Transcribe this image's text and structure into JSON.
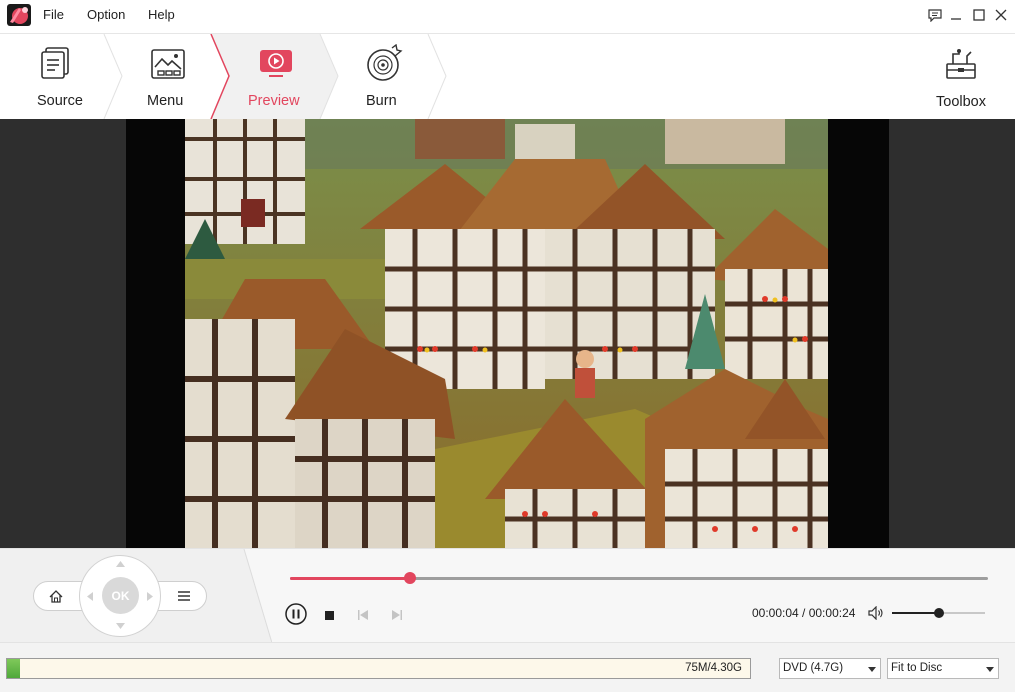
{
  "app": {
    "menu": [
      "File",
      "Option",
      "Help"
    ]
  },
  "steps": [
    {
      "label": "Source",
      "icon": "source-doc-icon",
      "active": false
    },
    {
      "label": "Menu",
      "icon": "menu-template-icon",
      "active": false
    },
    {
      "label": "Preview",
      "icon": "preview-play-icon",
      "active": true
    },
    {
      "label": "Burn",
      "icon": "burn-disc-icon",
      "active": false
    }
  ],
  "toolbox": {
    "label": "Toolbox",
    "icon": "toolbox-icon"
  },
  "remote": {
    "ok_label": "OK"
  },
  "player": {
    "elapsed": "00:00:04",
    "total": "00:00:24",
    "time_display": "00:00:04 / 00:00:24",
    "progress": 0.172,
    "volume": 0.5,
    "state": "playing"
  },
  "status": {
    "capacity_text": "75M/4.30G",
    "capacity_fraction": 0.017,
    "disc_type": "DVD (4.7G)",
    "fit_mode": "Fit to Disc"
  },
  "colors": {
    "accent": "#e2465e",
    "preview_bg": "#2e2e2e",
    "capacity_fill": "#5db545"
  }
}
